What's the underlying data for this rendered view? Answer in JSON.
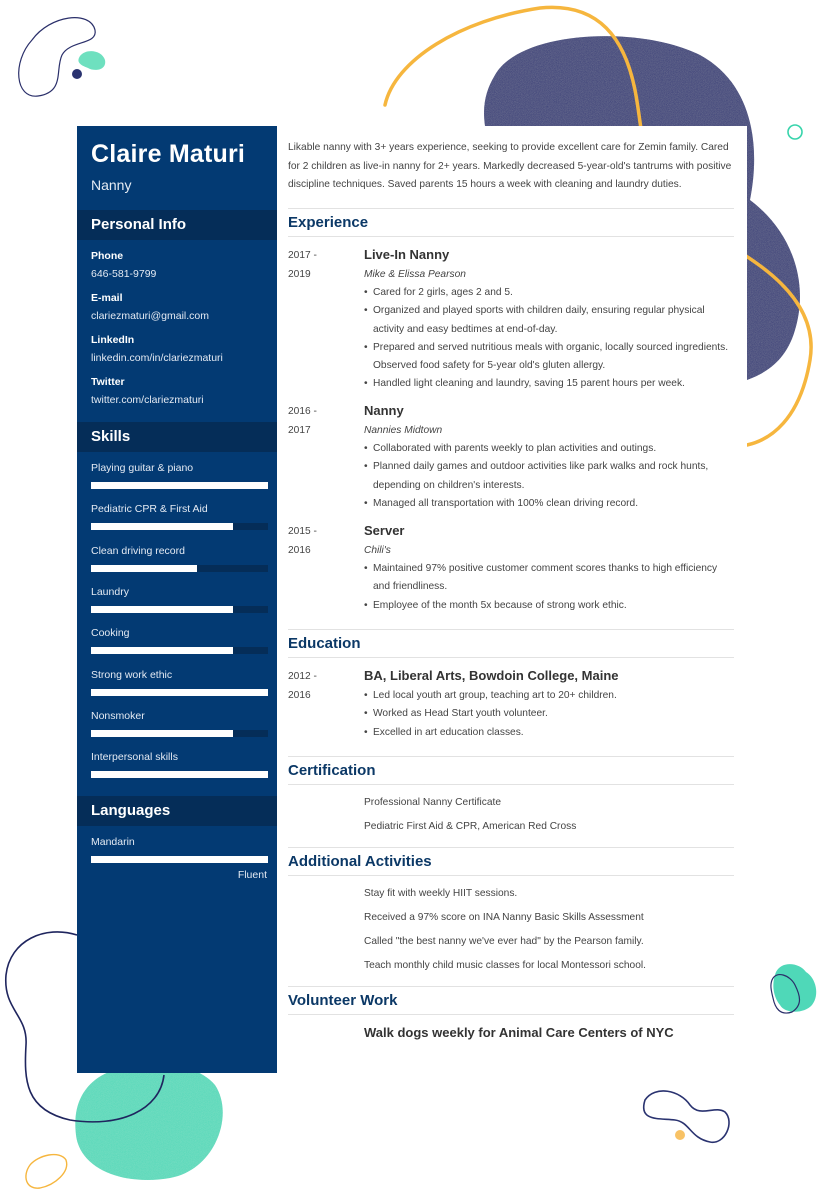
{
  "header": {
    "name": "Claire Maturi",
    "title": "Nanny"
  },
  "personal_info": {
    "heading": "Personal Info",
    "items": [
      {
        "label": "Phone",
        "value": "646-581-9799"
      },
      {
        "label": "E-mail",
        "value": "clariezmaturi@gmail.com"
      },
      {
        "label": "LinkedIn",
        "value": "linkedin.com/in/clariezmaturi"
      },
      {
        "label": "Twitter",
        "value": "twitter.com/clariezmaturi"
      }
    ]
  },
  "skills": {
    "heading": "Skills",
    "items": [
      {
        "name": "Playing guitar & piano",
        "level": 1.0
      },
      {
        "name": "Pediatric CPR & First Aid",
        "level": 0.8
      },
      {
        "name": "Clean driving record",
        "level": 0.6
      },
      {
        "name": "Laundry",
        "level": 0.8
      },
      {
        "name": "Cooking",
        "level": 0.8
      },
      {
        "name": "Strong work ethic",
        "level": 1.0
      },
      {
        "name": "Nonsmoker",
        "level": 0.8
      },
      {
        "name": "Interpersonal skills",
        "level": 1.0
      }
    ]
  },
  "languages": {
    "heading": "Languages",
    "items": [
      {
        "name": "Mandarin",
        "level": 1.0,
        "level_label": "Fluent"
      }
    ]
  },
  "summary": "Likable nanny with 3+ years experience, seeking to provide excellent care for Zemin family. Cared for 2 children as live-in nanny for 2+ years. Markedly decreased 5-year-old's tantrums with positive discipline techniques. Saved parents 15 hours a week with cleaning and laundry duties.",
  "experience": {
    "heading": "Experience",
    "entries": [
      {
        "date_start": "2017 -",
        "date_end": "2019",
        "title": "Live-In Nanny",
        "company": "Mike & Elissa Pearson",
        "bullets": [
          "Cared for 2 girls, ages 2 and 5.",
          "Organized and played sports with children daily, ensuring regular physical activity and easy bedtimes at end-of-day.",
          "Prepared and served nutritious meals with organic, locally sourced ingredients. Observed food safety for 5-year old's gluten allergy.",
          "Handled light cleaning and laundry, saving 15 parent hours per week."
        ]
      },
      {
        "date_start": "2016 -",
        "date_end": "2017",
        "title": "Nanny",
        "company": "Nannies Midtown",
        "bullets": [
          "Collaborated with parents weekly to plan activities and outings.",
          "Planned daily games and outdoor activities like park walks and rock hunts, depending on children's interests.",
          "Managed all transportation with 100% clean driving record."
        ]
      },
      {
        "date_start": "2015 -",
        "date_end": "2016",
        "title": "Server",
        "company": "Chili's",
        "bullets": [
          "Maintained 97% positive customer comment scores thanks to high efficiency and friendliness.",
          "Employee of the month 5x because of strong work ethic."
        ]
      }
    ]
  },
  "education": {
    "heading": "Education",
    "entries": [
      {
        "date_start": "2012 -",
        "date_end": "2016",
        "title": "BA, Liberal Arts, Bowdoin College, Maine",
        "bullets": [
          "Led local youth art group, teaching art to 20+ children.",
          "Worked as Head Start youth volunteer.",
          "Excelled in art education classes."
        ]
      }
    ]
  },
  "certification": {
    "heading": "Certification",
    "items": [
      "Professional Nanny Certificate",
      "Pediatric First Aid & CPR, American Red Cross"
    ]
  },
  "additional_activities": {
    "heading": "Additional Activities",
    "items": [
      "Stay fit with weekly HIIT sessions.",
      "Received a 97% score on INA Nanny Basic Skills Assessment",
      "Called \"the best nanny we've ever had\" by the Pearson family.",
      "Teach monthly child music classes for local Montessori school."
    ]
  },
  "volunteer_work": {
    "heading": "Volunteer Work",
    "item": "Walk dogs weekly for Animal Care Centers of NYC"
  },
  "colors": {
    "sidebar": "#033a73",
    "sidebar_band": "#052d58",
    "heading_text": "#0b3866",
    "body_text": "#444444",
    "accent_navy_blob": "#2e3675",
    "accent_yellow": "#f6b63e",
    "accent_teal": "#4fd8b8"
  }
}
